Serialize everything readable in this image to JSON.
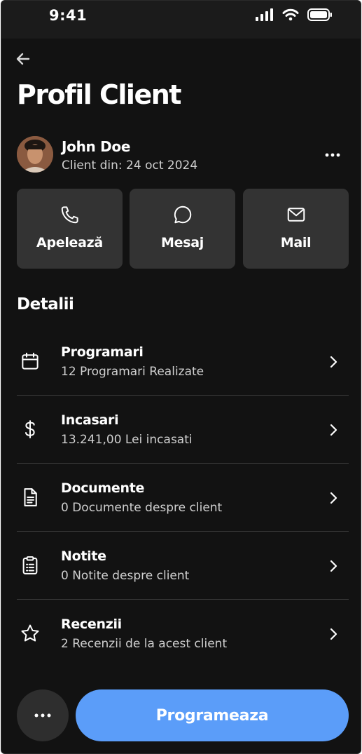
{
  "status_bar": {
    "time": "9:41"
  },
  "header": {
    "title": "Profil Client"
  },
  "client": {
    "name": "John Doe",
    "since": "Client din: 24 oct 2024"
  },
  "actions": [
    {
      "label": "Apelează",
      "icon": "phone-icon"
    },
    {
      "label": "Mesaj",
      "icon": "chat-bubble-icon"
    },
    {
      "label": "Mail",
      "icon": "mail-icon"
    }
  ],
  "details": {
    "title": "Detalii",
    "items": [
      {
        "title": "Programari",
        "subtitle": "12 Programari Realizate",
        "icon": "calendar-icon"
      },
      {
        "title": "Incasari",
        "subtitle": "13.241,00 Lei incasati",
        "icon": "dollar-icon"
      },
      {
        "title": "Documente",
        "subtitle": "0 Documente despre client",
        "icon": "document-icon"
      },
      {
        "title": "Notite",
        "subtitle": "0 Notite despre client",
        "icon": "clipboard-icon"
      },
      {
        "title": "Recenzii",
        "subtitle": "2 Recenzii de la acest client",
        "icon": "star-icon"
      }
    ]
  },
  "bottom": {
    "cta_label": "Programeaza"
  },
  "colors": {
    "background": "#121212",
    "card": "#333333",
    "accent": "#5b9df9",
    "divider": "#3a3a3a"
  }
}
